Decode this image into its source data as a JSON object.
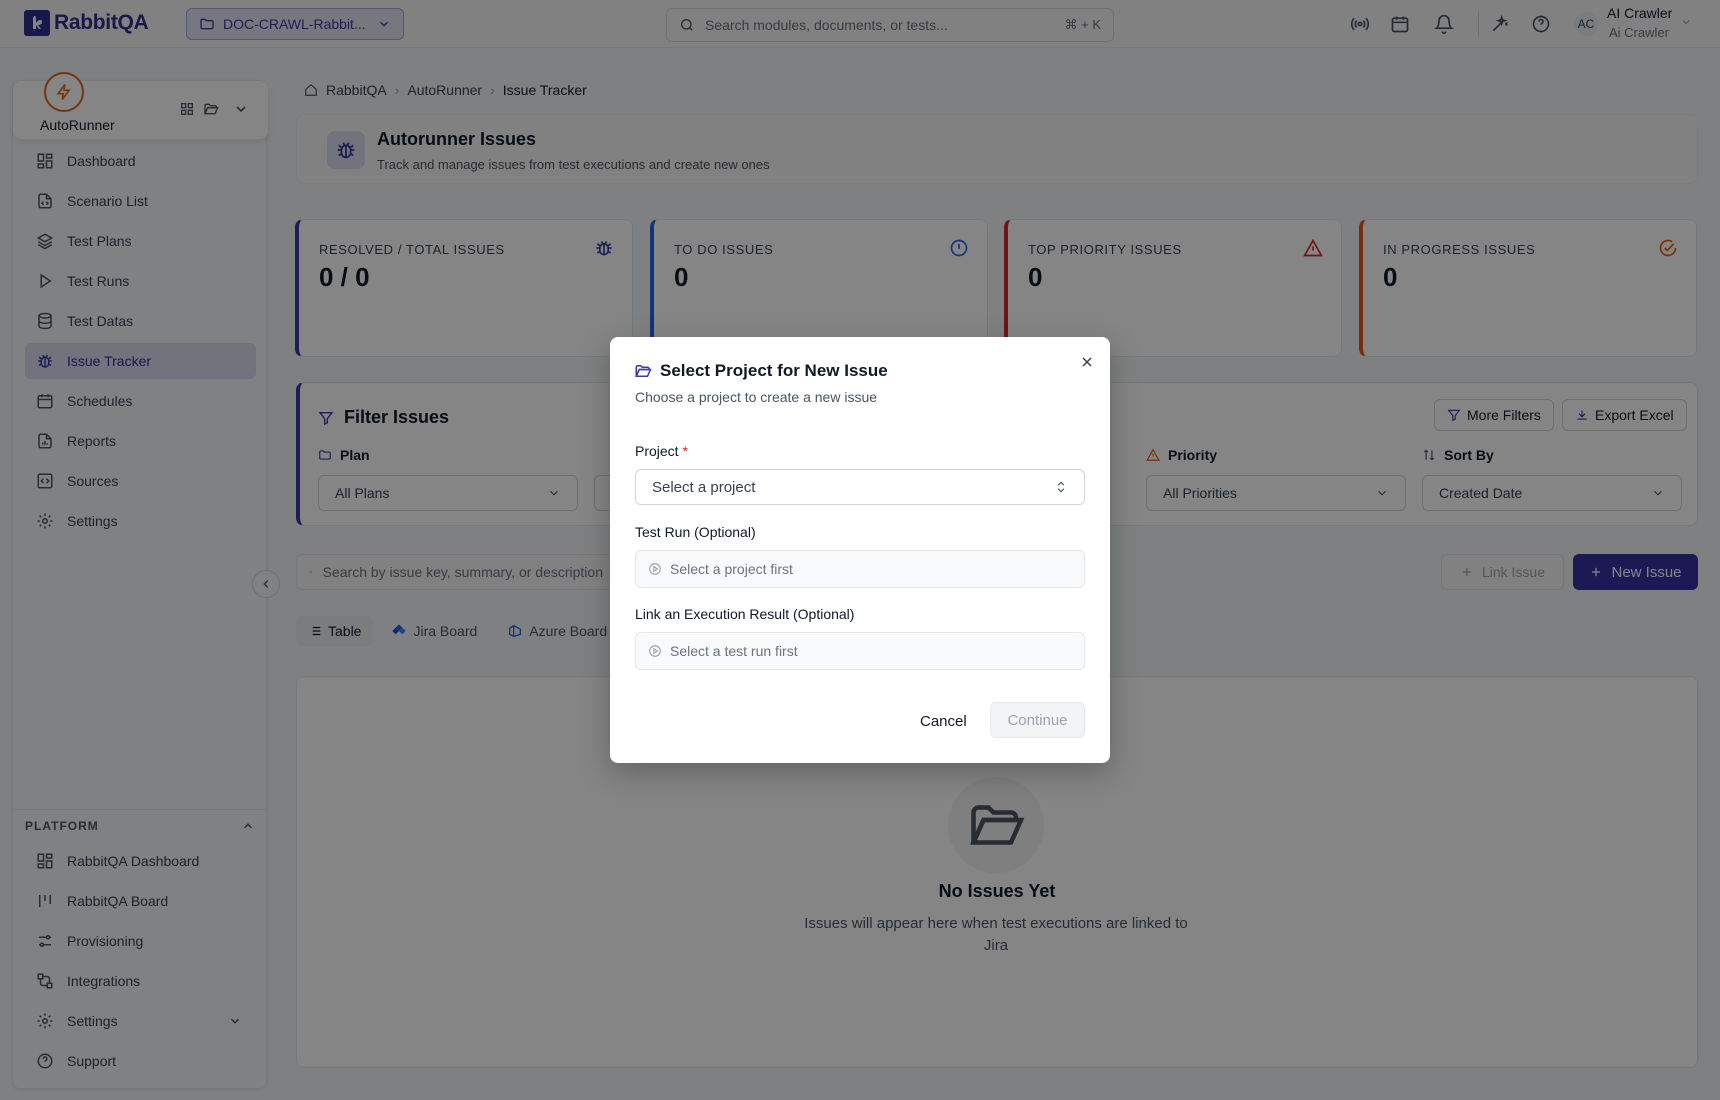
{
  "app": {
    "name": "RabbitQA",
    "brand_color": "#2f2e8f",
    "accent_color": "#3730a3"
  },
  "topbar": {
    "project_selector": "DOC-CRAWL-Rabbit...",
    "search_placeholder": "Search modules, documents, or tests...",
    "search_shortcut": "⌘ + K",
    "user": {
      "initials": "AC",
      "name": "AI Crawler",
      "role": "Ai Crawler"
    }
  },
  "sidebar": {
    "module": {
      "name": "AutoRunner",
      "icon": "lightning-icon"
    },
    "items": [
      {
        "label": "Dashboard",
        "icon": "layout-grid-icon"
      },
      {
        "label": "Scenario List",
        "icon": "file-code-icon"
      },
      {
        "label": "Test Plans",
        "icon": "layers-icon"
      },
      {
        "label": "Test Runs",
        "icon": "play-icon"
      },
      {
        "label": "Test Datas",
        "icon": "database-icon"
      },
      {
        "label": "Issue Tracker",
        "icon": "bug-icon",
        "active": true
      },
      {
        "label": "Schedules",
        "icon": "calendar-icon"
      },
      {
        "label": "Reports",
        "icon": "report-icon"
      },
      {
        "label": "Sources",
        "icon": "code-icon"
      },
      {
        "label": "Settings",
        "icon": "gear-icon"
      }
    ],
    "platform": {
      "heading": "PLATFORM",
      "items": [
        {
          "label": "RabbitQA Dashboard",
          "icon": "layout-grid-icon"
        },
        {
          "label": "RabbitQA Board",
          "icon": "board-icon"
        },
        {
          "label": "Provisioning",
          "icon": "sliders-icon"
        },
        {
          "label": "Integrations",
          "icon": "integrations-icon"
        },
        {
          "label": "Settings",
          "icon": "gear-icon"
        },
        {
          "label": "Support",
          "icon": "help-icon"
        }
      ]
    }
  },
  "breadcrumb": [
    "RabbitQA",
    "AutoRunner",
    "Issue Tracker"
  ],
  "header": {
    "title": "Autorunner Issues",
    "subtitle": "Track and manage issues from test executions and create new ones"
  },
  "stats": [
    {
      "label": "RESOLVED / TOTAL ISSUES",
      "value": "0 / 0",
      "color": "#3b3aa3",
      "icon": "bug-icon"
    },
    {
      "label": "TO DO ISSUES",
      "value": "0",
      "color": "#2563eb",
      "icon": "info-circle-icon"
    },
    {
      "label": "TOP PRIORITY ISSUES",
      "value": "0",
      "color": "#dc2626",
      "icon": "warning-icon"
    },
    {
      "label": "IN PROGRESS ISSUES",
      "value": "0",
      "color": "#ea580c",
      "icon": "check-circle-icon"
    }
  ],
  "filters": {
    "title": "Filter Issues",
    "more_filters": "More Filters",
    "export": "Export Excel",
    "plan": {
      "label": "Plan",
      "value": "All Plans"
    },
    "priority": {
      "label": "Priority",
      "value": "All Priorities"
    },
    "sort": {
      "label": "Sort By",
      "value": "Created Date"
    }
  },
  "issue_search": {
    "placeholder": "Search by issue key, summary, or description"
  },
  "actions": {
    "link_issue": "Link Issue",
    "new_issue": "New Issue"
  },
  "views": [
    {
      "label": "Table",
      "active": true
    },
    {
      "label": "Jira Board"
    },
    {
      "label": "Azure Board"
    }
  ],
  "empty": {
    "title": "No Issues Yet",
    "text": "Issues will appear here when test executions are linked to Jira"
  },
  "modal": {
    "title": "Select Project for New Issue",
    "subtitle": "Choose a project to create a new issue",
    "project_label": "Project",
    "required_mark": "*",
    "project_placeholder": "Select a project",
    "test_run_label": "Test Run (Optional)",
    "test_run_placeholder": "Select a project first",
    "execution_label": "Link an Execution Result (Optional)",
    "execution_placeholder": "Select a test run first",
    "cancel": "Cancel",
    "continue": "Continue"
  }
}
